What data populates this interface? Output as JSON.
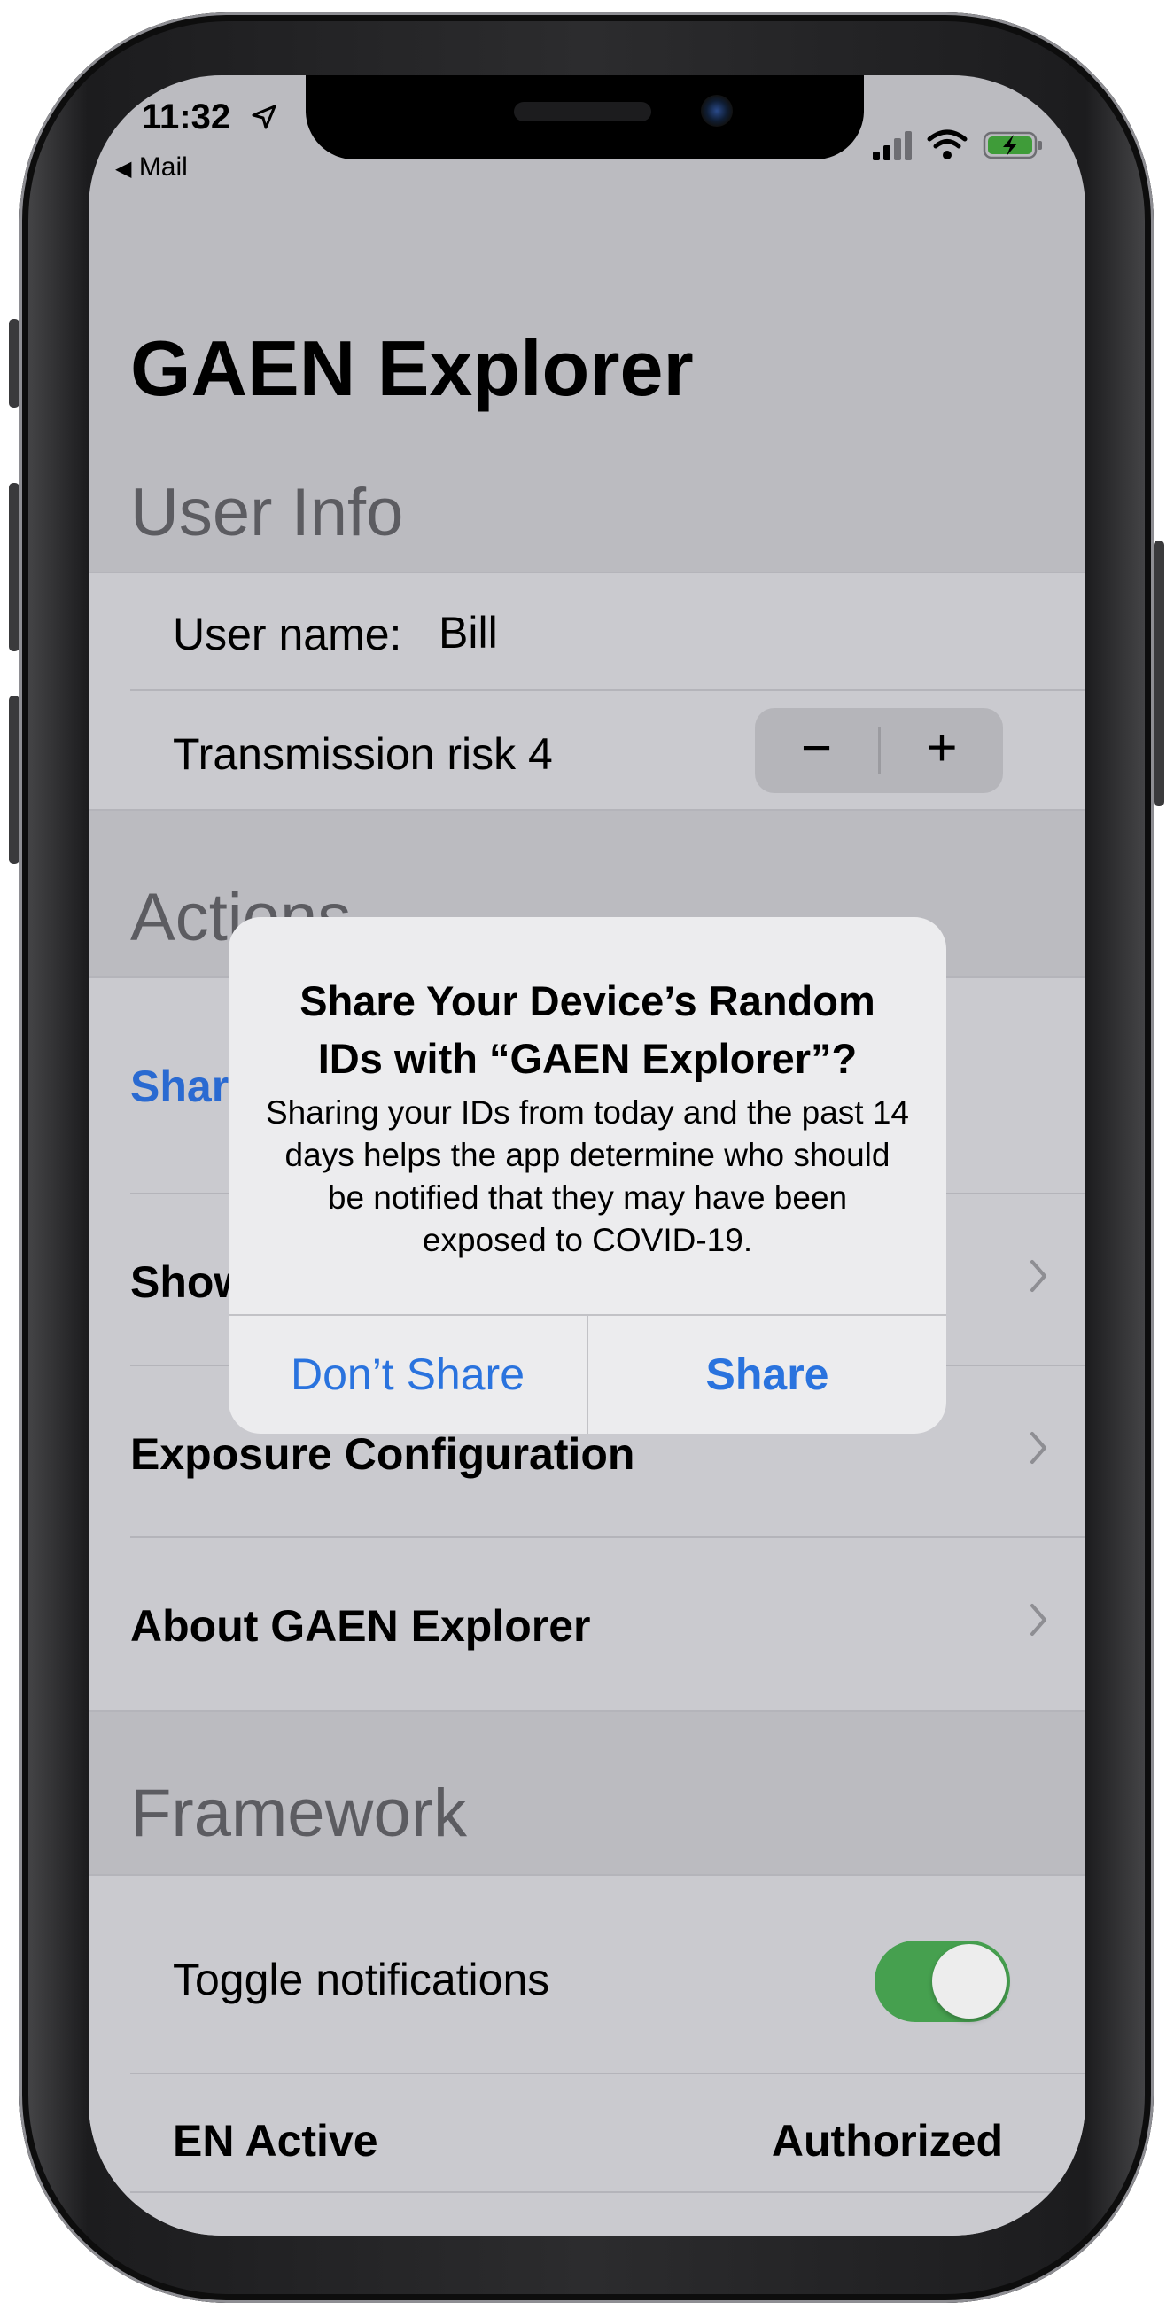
{
  "status_bar": {
    "time": "11:32",
    "back_app": "Mail",
    "battery_color": "#3f9c39"
  },
  "app": {
    "title": "GAEN Explorer"
  },
  "sections": {
    "user_info": {
      "header": "User Info",
      "user_name_label": "User name:",
      "user_name_value": "Bill",
      "transmission_risk_label": "Transmission risk 4",
      "stepper_minus": "−",
      "stepper_plus": "+"
    },
    "actions": {
      "header": "Actions",
      "items": [
        {
          "label": "Share"
        },
        {
          "label": "Show"
        },
        {
          "label": "Exposure Configuration"
        },
        {
          "label": "About GAEN Explorer"
        }
      ]
    },
    "framework": {
      "header": "Framework",
      "toggle_label": "Toggle notifications",
      "toggle_on": true,
      "en_label": "EN Active",
      "en_value": "Authorized"
    }
  },
  "alert": {
    "title": "Share Your Device’s Random IDs with “GAEN Explorer”?",
    "message": "Sharing your IDs from today and the past 14 days helps the app determine who should be notified that they may have been exposed to COVID-19.",
    "cancel_button": "Don’t Share",
    "confirm_button": "Share"
  },
  "colors": {
    "accent_blue": "#2a73de",
    "toggle_green": "#46a04f"
  }
}
